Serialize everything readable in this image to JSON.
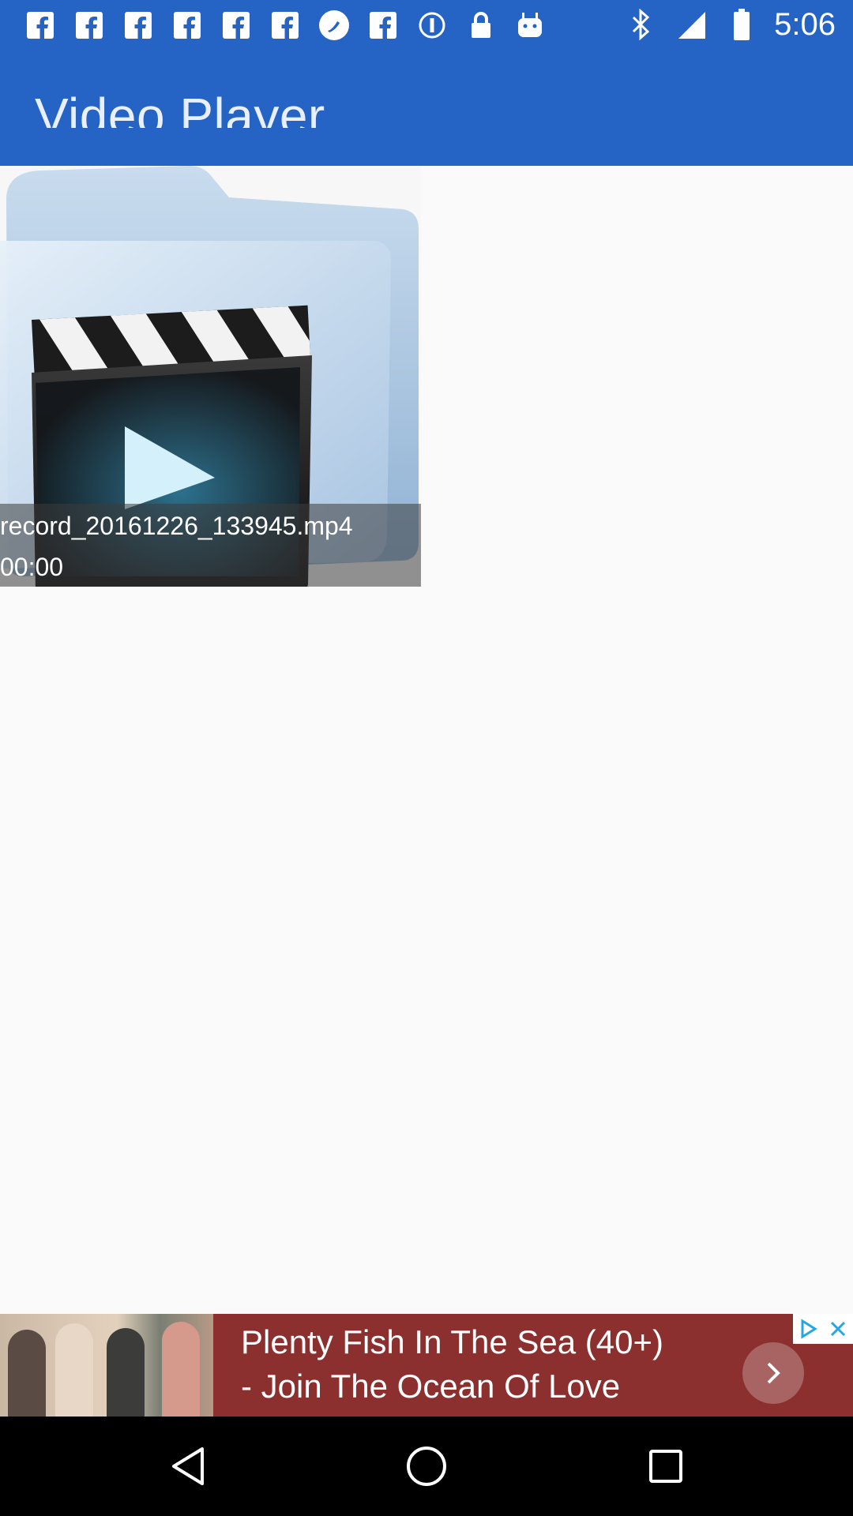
{
  "status_bar": {
    "left_icons": [
      "facebook-icon",
      "facebook-icon",
      "facebook-icon",
      "facebook-icon",
      "facebook-icon",
      "facebook-icon",
      "pen-app-icon",
      "facebook-icon",
      "info-icon",
      "lock-icon",
      "android-icon"
    ],
    "right_icons": [
      "bluetooth-icon",
      "signal-icon",
      "battery-icon"
    ],
    "time": "5:06"
  },
  "app_bar": {
    "title": "Video Player",
    "color": "#2563c5"
  },
  "videos": [
    {
      "name": "record_20161226_133945.mp4",
      "duration": "00:00",
      "thumbnail_icon": "video-folder-icon"
    }
  ],
  "ad_banner": {
    "text_line1": "Plenty Fish In The Sea (40+)",
    "text_line2": "- Join The Ocean Of Love",
    "next_icon": "chevron-right-icon",
    "choices_icon": "adchoices-icon",
    "close_icon": "close-icon",
    "background": "#8b2f2f"
  },
  "nav_bar": {
    "back_icon": "back-triangle-icon",
    "home_icon": "home-circle-icon",
    "recents_icon": "recents-square-icon"
  }
}
